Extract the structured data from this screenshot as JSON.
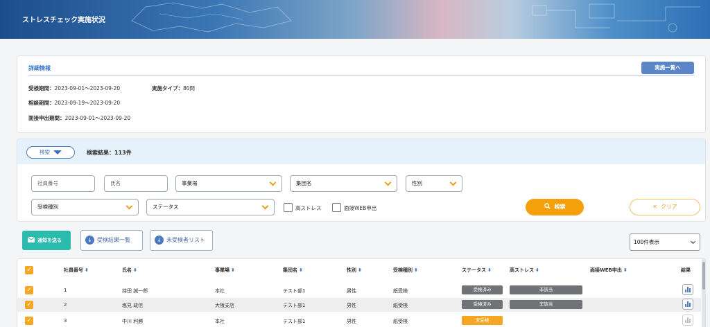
{
  "header": {
    "title": "ストレスチェック実施状況"
  },
  "detail": {
    "section_title": "詳細情報",
    "list_button": "実施一覧へ",
    "exam_period_label": "受検期間：",
    "exam_period_value": "2023-09-01～2023-09-20",
    "type_label": "実施タイプ：",
    "type_value": "80問",
    "consult_period_label": "相談期間：",
    "consult_period_value": "2023-09-19～2023-09-20",
    "interview_period_label": "面接申出期間：",
    "interview_period_value": "2023-09-01～2023-09-20"
  },
  "search": {
    "toggle_label": "検索",
    "result_label": "検索結果：113件",
    "employee_no_placeholder": "社員番号",
    "name_placeholder": "氏名",
    "office": "事業場",
    "group": "集団名",
    "gender": "性別",
    "exam_type": "受検種別",
    "status": "ステータス",
    "high_stress": "高ストレス",
    "web_interview": "面接WEB申出",
    "search_button": "検索",
    "clear_button": "クリア"
  },
  "actions": {
    "notify": "通知を送る",
    "results_list": "受検結果一覧",
    "untaken_list": "未受検者リスト",
    "per_page": "100件表示"
  },
  "table": {
    "headers": {
      "employee_no": "社員番号",
      "name": "氏名",
      "office": "事業場",
      "group": "集団名",
      "gender": "性別",
      "exam_type": "受検種別",
      "status": "ステータス",
      "high_stress": "高ストレス",
      "web_interview": "面接WEB申出",
      "result": "結果"
    },
    "rows": [
      {
        "no": "1",
        "name": "持田 誠一郎",
        "office": "本社",
        "group": "テスト部1",
        "gender": "男性",
        "exam_type": "紙受検",
        "status": "受検済み",
        "high_stress": "非該当"
      },
      {
        "no": "2",
        "name": "塩見 政信",
        "office": "大阪支店",
        "group": "テスト部1",
        "gender": "男性",
        "exam_type": "紙受検",
        "status": "受検済み",
        "high_stress": "非該当"
      },
      {
        "no": "3",
        "name": "中川 利勝",
        "office": "本社",
        "group": "テスト部1",
        "gender": "男性",
        "exam_type": "紙受検",
        "status": "未受検",
        "high_stress": ""
      }
    ]
  },
  "colors": {
    "accent_orange": "#f5a623",
    "primary_blue": "#4a78c2",
    "teal": "#2bbbad"
  },
  "icons": [
    "caret-down-icon",
    "search-icon",
    "close-icon",
    "mail-icon",
    "download-icon",
    "sort-icon",
    "bar-chart-icon",
    "checkbox-checked-icon"
  ]
}
